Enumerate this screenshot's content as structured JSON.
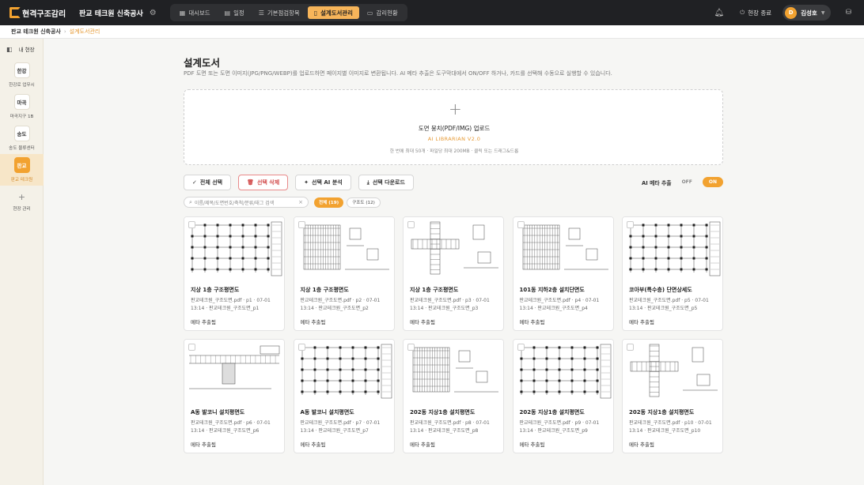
{
  "header": {
    "logo": "현격구조감리",
    "project": "판교 테크원 신축공사",
    "nav": [
      {
        "label": "대시보드",
        "icon": "dashboard-icon",
        "active": false
      },
      {
        "label": "일정",
        "icon": "calendar-icon",
        "active": false
      },
      {
        "label": "기본점검항목",
        "icon": "checklist-icon",
        "active": false
      },
      {
        "label": "설계도서관리",
        "icon": "document-icon",
        "active": true
      },
      {
        "label": "감리현황",
        "icon": "clipboard-icon",
        "active": false
      }
    ],
    "exit_label": "현장 종료",
    "user": {
      "initial": "D",
      "name": "김성호"
    }
  },
  "breadcrumb": {
    "root": "판교 테크원 신축공사",
    "current": "설계도서관리"
  },
  "sidebar": {
    "heading": "내 현장",
    "sites": [
      {
        "badge": "한강",
        "label": "한강로 업무시",
        "active": false
      },
      {
        "badge": "마곡",
        "label": "마곡지구 1B",
        "active": false
      },
      {
        "badge": "송도",
        "label": "송도 물류센터",
        "active": false
      },
      {
        "badge": "판교",
        "label": "판교 테크원",
        "active": true
      }
    ],
    "manage_label": "현장 관리"
  },
  "page": {
    "title": "설계도서",
    "description": "PDF 도면 또는 도면 이미지(JPG/PNG/WEBP)를 업로드하면 페이지별 이미지로 변환됩니다. AI 메타 추출은 도구막대에서 ON/OFF 하거나, 카드를 선택해 수동으로 실행할 수 있습니다."
  },
  "upload": {
    "title": "도면 뭉치(PDF/IMG) 업로드",
    "version": "AI LIBRARIAN V2.0",
    "hint": "한 번에 최대 50개 · 파일당 최대 200MB · 클릭 또는 드래그&드롭"
  },
  "toolbar": {
    "select_all": "전체 선택",
    "delete_selected": "선택 삭제",
    "ai_analyze": "선택 AI 분석",
    "download_selected": "선택 다운로드",
    "ai_meta_label": "AI 메타 추출",
    "off_label": "OFF",
    "on_label": "ON"
  },
  "filters": {
    "search_placeholder": "이름/제목/도면번호/축척/분류/태그 검색",
    "chips": [
      {
        "label": "전체 (19)",
        "active": true
      },
      {
        "label": "구조도 (12)",
        "active": false
      }
    ]
  },
  "cards": [
    {
      "title": "지상 1층 구조평면도",
      "meta1": "판교테크원_구조도면.pdf · p1 · 07-01",
      "meta2": "13:14 · 판교테크원_구조도면_p1",
      "status": "메타 추출됨",
      "kind": "plan"
    },
    {
      "title": "지상 1층 구조평면도",
      "meta1": "판교테크원_구조도면.pdf · p2 · 07-01",
      "meta2": "13:14 · 판교테크원_구조도면_p2",
      "status": "메타 추출됨",
      "kind": "rebar"
    },
    {
      "title": "지상 1층 구조평면도",
      "meta1": "판교테크원_구조도면.pdf · p3 · 07-01",
      "meta2": "13:14 · 판교테크원_구조도면_p3",
      "status": "메타 추출됨",
      "kind": "cross"
    },
    {
      "title": "101동 지하2층 설치단면도",
      "meta1": "판교테크원_구조도면.pdf · p4 · 07-01",
      "meta2": "13:14 · 판교테크원_구조도면_p4",
      "status": "메타 추출됨",
      "kind": "rebar"
    },
    {
      "title": "코아부(특수층) 단면상세도",
      "meta1": "판교테크원_구조도면.pdf · p5 · 07-01",
      "meta2": "13:14 · 판교테크원_구조도면_p5",
      "status": "메타 추출됨",
      "kind": "plan"
    },
    {
      "title": "A동 발코니 설치평면도",
      "meta1": "판교테크원_구조도면.pdf · p6 · 07-01",
      "meta2": "13:14 · 판교테크원_구조도면_p6",
      "status": "메타 추출됨",
      "kind": "beam"
    },
    {
      "title": "A동 발코니 설치평면도",
      "meta1": "판교테크원_구조도면.pdf · p7 · 07-01",
      "meta2": "13:14 · 판교테크원_구조도면_p7",
      "status": "메타 추출됨",
      "kind": "plan"
    },
    {
      "title": "202동 지상1층 설치평면도",
      "meta1": "판교테크원_구조도면.pdf · p8 · 07-01",
      "meta2": "13:14 · 판교테크원_구조도면_p8",
      "status": "메타 추출됨",
      "kind": "rebar"
    },
    {
      "title": "202동 지상1층 설치평면도",
      "meta1": "판교테크원_구조도면.pdf · p9 · 07-01",
      "meta2": "13:14 · 판교테크원_구조도면_p9",
      "status": "메타 추출됨",
      "kind": "plan"
    },
    {
      "title": "202동 지상1층 설치평면도",
      "meta1": "판교테크원_구조도면.pdf · p10 · 07-01",
      "meta2": "13:14 · 판교테크원_구조도면_p10",
      "status": "메타 추출됨",
      "kind": "cross"
    }
  ],
  "colors": {
    "accent": "#f2a230",
    "topbar": "#202124",
    "danger": "#d24c4c"
  }
}
